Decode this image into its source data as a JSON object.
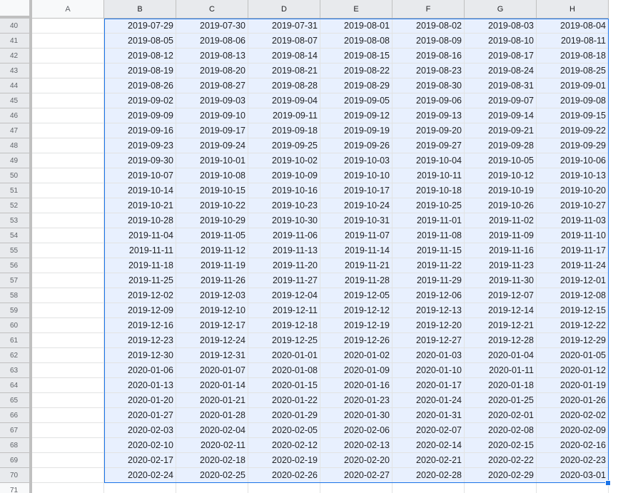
{
  "columns": [
    "A",
    "B",
    "C",
    "D",
    "E",
    "F",
    "G",
    "H"
  ],
  "selected_columns": [
    "B",
    "C",
    "D",
    "E",
    "F",
    "G",
    "H"
  ],
  "rows": [
    {
      "num": "40",
      "cells": [
        "",
        "2019-07-29",
        "2019-07-30",
        "2019-07-31",
        "2019-08-01",
        "2019-08-02",
        "2019-08-03",
        "2019-08-04"
      ]
    },
    {
      "num": "41",
      "cells": [
        "",
        "2019-08-05",
        "2019-08-06",
        "2019-08-07",
        "2019-08-08",
        "2019-08-09",
        "2019-08-10",
        "2019-08-11"
      ]
    },
    {
      "num": "42",
      "cells": [
        "",
        "2019-08-12",
        "2019-08-13",
        "2019-08-14",
        "2019-08-15",
        "2019-08-16",
        "2019-08-17",
        "2019-08-18"
      ]
    },
    {
      "num": "43",
      "cells": [
        "",
        "2019-08-19",
        "2019-08-20",
        "2019-08-21",
        "2019-08-22",
        "2019-08-23",
        "2019-08-24",
        "2019-08-25"
      ]
    },
    {
      "num": "44",
      "cells": [
        "",
        "2019-08-26",
        "2019-08-27",
        "2019-08-28",
        "2019-08-29",
        "2019-08-30",
        "2019-08-31",
        "2019-09-01"
      ]
    },
    {
      "num": "45",
      "cells": [
        "",
        "2019-09-02",
        "2019-09-03",
        "2019-09-04",
        "2019-09-05",
        "2019-09-06",
        "2019-09-07",
        "2019-09-08"
      ]
    },
    {
      "num": "46",
      "cells": [
        "",
        "2019-09-09",
        "2019-09-10",
        "2019-09-11",
        "2019-09-12",
        "2019-09-13",
        "2019-09-14",
        "2019-09-15"
      ]
    },
    {
      "num": "47",
      "cells": [
        "",
        "2019-09-16",
        "2019-09-17",
        "2019-09-18",
        "2019-09-19",
        "2019-09-20",
        "2019-09-21",
        "2019-09-22"
      ]
    },
    {
      "num": "48",
      "cells": [
        "",
        "2019-09-23",
        "2019-09-24",
        "2019-09-25",
        "2019-09-26",
        "2019-09-27",
        "2019-09-28",
        "2019-09-29"
      ]
    },
    {
      "num": "49",
      "cells": [
        "",
        "2019-09-30",
        "2019-10-01",
        "2019-10-02",
        "2019-10-03",
        "2019-10-04",
        "2019-10-05",
        "2019-10-06"
      ]
    },
    {
      "num": "50",
      "cells": [
        "",
        "2019-10-07",
        "2019-10-08",
        "2019-10-09",
        "2019-10-10",
        "2019-10-11",
        "2019-10-12",
        "2019-10-13"
      ]
    },
    {
      "num": "51",
      "cells": [
        "",
        "2019-10-14",
        "2019-10-15",
        "2019-10-16",
        "2019-10-17",
        "2019-10-18",
        "2019-10-19",
        "2019-10-20"
      ]
    },
    {
      "num": "52",
      "cells": [
        "",
        "2019-10-21",
        "2019-10-22",
        "2019-10-23",
        "2019-10-24",
        "2019-10-25",
        "2019-10-26",
        "2019-10-27"
      ]
    },
    {
      "num": "53",
      "cells": [
        "",
        "2019-10-28",
        "2019-10-29",
        "2019-10-30",
        "2019-10-31",
        "2019-11-01",
        "2019-11-02",
        "2019-11-03"
      ]
    },
    {
      "num": "54",
      "cells": [
        "",
        "2019-11-04",
        "2019-11-05",
        "2019-11-06",
        "2019-11-07",
        "2019-11-08",
        "2019-11-09",
        "2019-11-10"
      ]
    },
    {
      "num": "55",
      "cells": [
        "",
        "2019-11-11",
        "2019-11-12",
        "2019-11-13",
        "2019-11-14",
        "2019-11-15",
        "2019-11-16",
        "2019-11-17"
      ]
    },
    {
      "num": "56",
      "cells": [
        "",
        "2019-11-18",
        "2019-11-19",
        "2019-11-20",
        "2019-11-21",
        "2019-11-22",
        "2019-11-23",
        "2019-11-24"
      ]
    },
    {
      "num": "57",
      "cells": [
        "",
        "2019-11-25",
        "2019-11-26",
        "2019-11-27",
        "2019-11-28",
        "2019-11-29",
        "2019-11-30",
        "2019-12-01"
      ]
    },
    {
      "num": "58",
      "cells": [
        "",
        "2019-12-02",
        "2019-12-03",
        "2019-12-04",
        "2019-12-05",
        "2019-12-06",
        "2019-12-07",
        "2019-12-08"
      ]
    },
    {
      "num": "59",
      "cells": [
        "",
        "2019-12-09",
        "2019-12-10",
        "2019-12-11",
        "2019-12-12",
        "2019-12-13",
        "2019-12-14",
        "2019-12-15"
      ]
    },
    {
      "num": "60",
      "cells": [
        "",
        "2019-12-16",
        "2019-12-17",
        "2019-12-18",
        "2019-12-19",
        "2019-12-20",
        "2019-12-21",
        "2019-12-22"
      ]
    },
    {
      "num": "61",
      "cells": [
        "",
        "2019-12-23",
        "2019-12-24",
        "2019-12-25",
        "2019-12-26",
        "2019-12-27",
        "2019-12-28",
        "2019-12-29"
      ]
    },
    {
      "num": "62",
      "cells": [
        "",
        "2019-12-30",
        "2019-12-31",
        "2020-01-01",
        "2020-01-02",
        "2020-01-03",
        "2020-01-04",
        "2020-01-05"
      ]
    },
    {
      "num": "63",
      "cells": [
        "",
        "2020-01-06",
        "2020-01-07",
        "2020-01-08",
        "2020-01-09",
        "2020-01-10",
        "2020-01-11",
        "2020-01-12"
      ]
    },
    {
      "num": "64",
      "cells": [
        "",
        "2020-01-13",
        "2020-01-14",
        "2020-01-15",
        "2020-01-16",
        "2020-01-17",
        "2020-01-18",
        "2020-01-19"
      ]
    },
    {
      "num": "65",
      "cells": [
        "",
        "2020-01-20",
        "2020-01-21",
        "2020-01-22",
        "2020-01-23",
        "2020-01-24",
        "2020-01-25",
        "2020-01-26"
      ]
    },
    {
      "num": "66",
      "cells": [
        "",
        "2020-01-27",
        "2020-01-28",
        "2020-01-29",
        "2020-01-30",
        "2020-01-31",
        "2020-02-01",
        "2020-02-02"
      ]
    },
    {
      "num": "67",
      "cells": [
        "",
        "2020-02-03",
        "2020-02-04",
        "2020-02-05",
        "2020-02-06",
        "2020-02-07",
        "2020-02-08",
        "2020-02-09"
      ]
    },
    {
      "num": "68",
      "cells": [
        "",
        "2020-02-10",
        "2020-02-11",
        "2020-02-12",
        "2020-02-13",
        "2020-02-14",
        "2020-02-15",
        "2020-02-16"
      ]
    },
    {
      "num": "69",
      "cells": [
        "",
        "2020-02-17",
        "2020-02-18",
        "2020-02-19",
        "2020-02-20",
        "2020-02-21",
        "2020-02-22",
        "2020-02-23"
      ]
    },
    {
      "num": "70",
      "cells": [
        "",
        "2020-02-24",
        "2020-02-25",
        "2020-02-26",
        "2020-02-27",
        "2020-02-28",
        "2020-02-29",
        "2020-03-01"
      ]
    },
    {
      "num": "71",
      "cells": [
        "",
        "",
        "",
        "",
        "",
        "",
        "",
        ""
      ]
    }
  ],
  "colors": {
    "selection_border": "#1a73e8",
    "selection_fill": "#e8f0fe",
    "header_bg": "#f8f9fa",
    "header_selected_bg": "#e8eaed",
    "gridline": "#e2e3e3"
  }
}
